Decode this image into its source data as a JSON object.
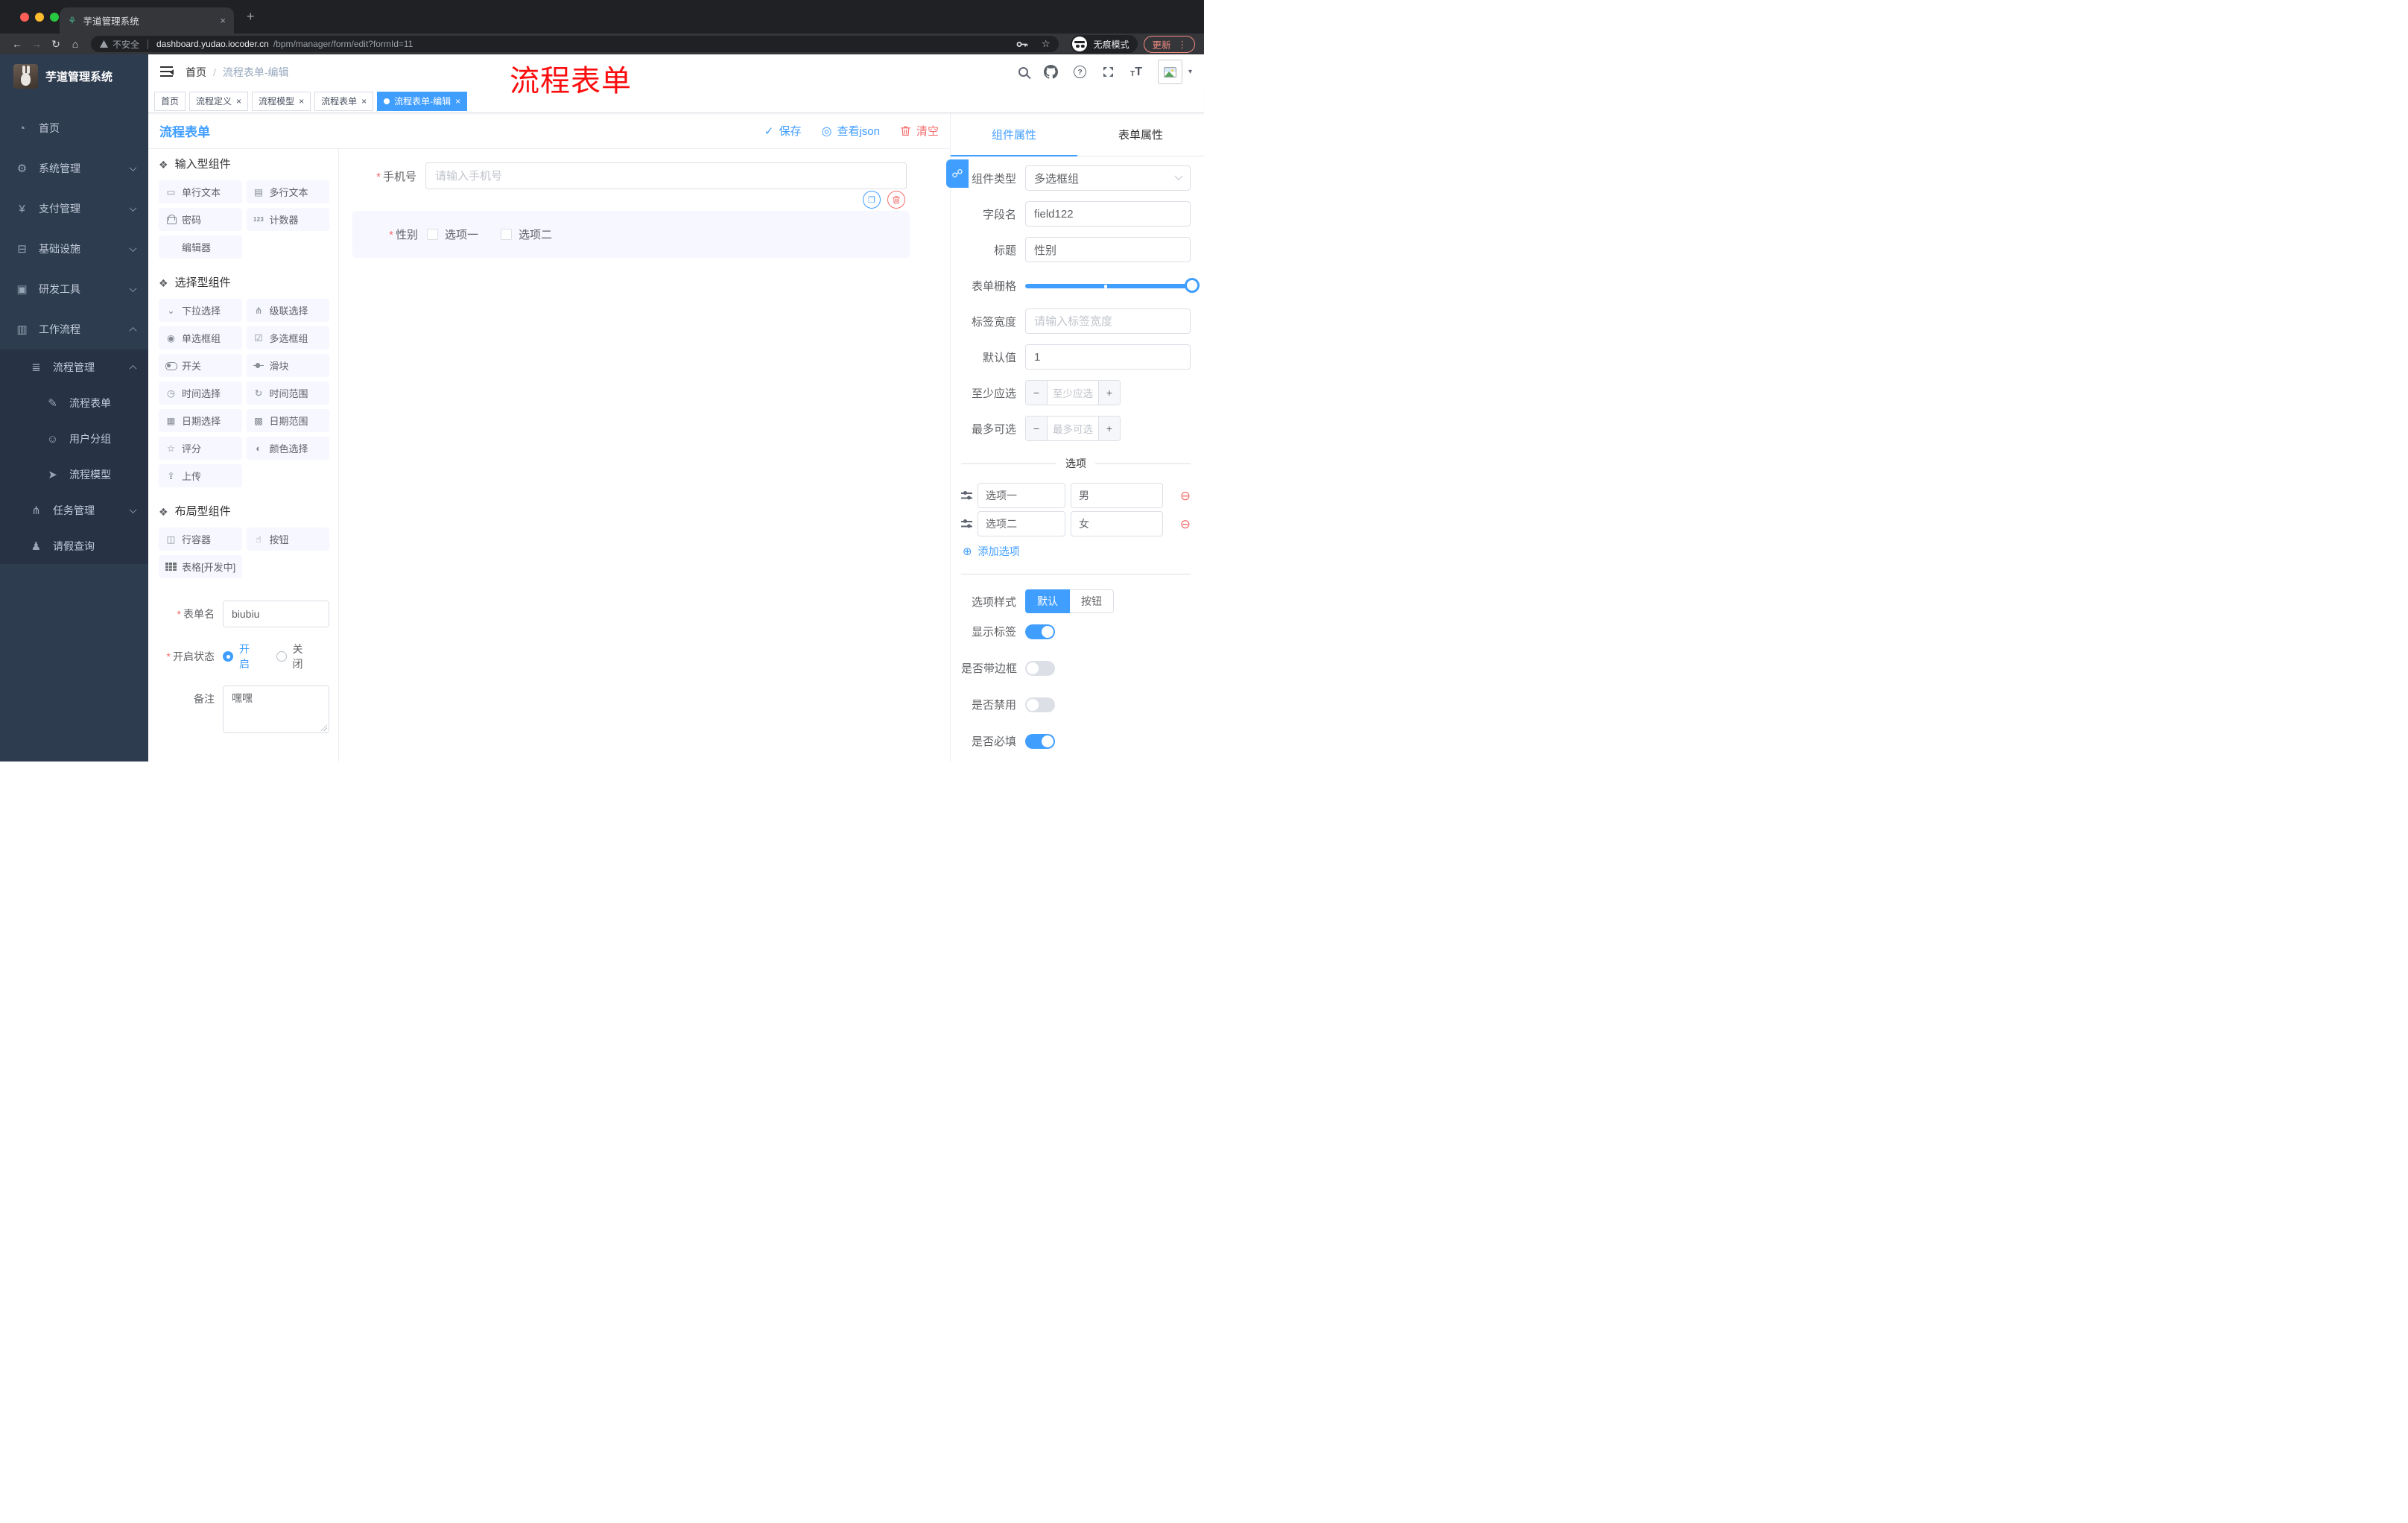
{
  "browser": {
    "tab_title": "芋道管理系统",
    "security": "不安全",
    "url_host": "dashboard.yudao.iocoder.cn",
    "url_path": "/bpm/manager/form/edit?formId=11",
    "incognito": "无痕模式",
    "update": "更新"
  },
  "icons": {
    "plant": "⚘",
    "close": "×",
    "new_tab": "+",
    "back": "←",
    "forward": "→",
    "reload": "↻",
    "home": "⌂",
    "star": "☆",
    "dots": "⋮",
    "caret": "▾",
    "section": "❖",
    "check": "✓",
    "eye": "◎",
    "copy": "❐",
    "chain": "☍",
    "minus": "−",
    "plus": "+",
    "minus_circle": "⊖",
    "plus_circle": "⊕",
    "asterisk": "*",
    "breadcrumb_sep": "/",
    "question": "?",
    "font_t": "T"
  },
  "sidebar": {
    "app_title": "芋道管理系统",
    "menu": [
      {
        "icon": "◔",
        "label": "首页",
        "level": 1
      },
      {
        "icon": "⚙",
        "label": "系统管理",
        "level": 1,
        "arrow": "down"
      },
      {
        "icon": "¥",
        "label": "支付管理",
        "level": 1,
        "arrow": "down"
      },
      {
        "icon": "⊟",
        "label": "基础设施",
        "level": 1,
        "arrow": "down"
      },
      {
        "icon": "▣",
        "label": "研发工具",
        "level": 1,
        "arrow": "down"
      },
      {
        "icon": "▥",
        "label": "工作流程",
        "level": 1,
        "arrow": "up"
      },
      {
        "icon": "≣",
        "label": "流程管理",
        "level": 2,
        "arrow": "up",
        "group": true
      },
      {
        "icon": "✎",
        "label": "流程表单",
        "level": 3,
        "group": true
      },
      {
        "icon": "☺",
        "label": "用户分组",
        "level": 3,
        "group": true
      },
      {
        "icon": "➤",
        "label": "流程模型",
        "level": 3,
        "group": true
      },
      {
        "icon": "⋔",
        "label": "任务管理",
        "level": 2,
        "arrow": "down",
        "group": true
      },
      {
        "icon": "♟",
        "label": "请假查询",
        "level": 2,
        "group": true
      }
    ]
  },
  "header": {
    "breadcrumb": [
      "首页",
      "流程表单-编辑"
    ],
    "overlay": "流程表单"
  },
  "tags": [
    {
      "label": "首页"
    },
    {
      "label": "流程定义",
      "closable": true
    },
    {
      "label": "流程模型",
      "closable": true
    },
    {
      "label": "流程表单",
      "closable": true
    },
    {
      "label": "流程表单-编辑",
      "closable": true,
      "active": true
    }
  ],
  "toolbar": {
    "title": "流程表单",
    "save": "保存",
    "view_json": "查看json",
    "clear": "清空"
  },
  "palette": {
    "sections": [
      {
        "title": "输入型组件",
        "items": [
          {
            "icon": "▭",
            "label": "单行文本"
          },
          {
            "icon": "▤",
            "label": "多行文本"
          },
          {
            "icon": "css:lock",
            "label": "密码"
          },
          {
            "icon": "123",
            "label": "计数器"
          },
          {
            "icon": "",
            "label": "编辑器"
          }
        ]
      },
      {
        "title": "选择型组件",
        "items": [
          {
            "icon": "⌄",
            "label": "下拉选择"
          },
          {
            "icon": "⋔",
            "label": "级联选择"
          },
          {
            "icon": "◉",
            "label": "单选框组"
          },
          {
            "icon": "☑",
            "label": "多选框组"
          },
          {
            "icon": "css:switch",
            "label": "开关"
          },
          {
            "icon": "css:sliderline",
            "label": "滑块"
          },
          {
            "icon": "◷",
            "label": "时间选择"
          },
          {
            "icon": "↻",
            "label": "时间范围"
          },
          {
            "icon": "▦",
            "label": "日期选择"
          },
          {
            "icon": "▩",
            "label": "日期范围"
          },
          {
            "icon": "☆",
            "label": "评分"
          },
          {
            "icon": "◐",
            "label": "颜色选择"
          },
          {
            "icon": "⇪",
            "label": "上传"
          }
        ]
      },
      {
        "title": "布局型组件",
        "items": [
          {
            "icon": "◫",
            "label": "行容器"
          },
          {
            "icon": "☝",
            "label": "按钮"
          },
          {
            "icon": "css:grid",
            "label": "表格[开发中]"
          }
        ]
      }
    ]
  },
  "builder_form": {
    "name_label": "表单名",
    "name_value": "biubiu",
    "status_label": "开启状态",
    "status_options": [
      {
        "label": "开启",
        "checked": true
      },
      {
        "label": "关闭",
        "checked": false
      }
    ],
    "remark_label": "备注",
    "remark_value": "嘿嘿"
  },
  "canvas": {
    "phone": {
      "label": "手机号",
      "required": true,
      "placeholder": "请输入手机号"
    },
    "gender": {
      "label": "性别",
      "required": true,
      "options": [
        "选项一",
        "选项二"
      ]
    }
  },
  "props_panel": {
    "tabs": [
      {
        "label": "组件属性",
        "active": true
      },
      {
        "label": "表单属性"
      }
    ],
    "component_type": {
      "label": "组件类型",
      "value": "多选框组"
    },
    "field_name": {
      "label": "字段名",
      "value": "field122"
    },
    "title": {
      "label": "标题",
      "value": "性别"
    },
    "grid": {
      "label": "表单栅格"
    },
    "label_width": {
      "label": "标签宽度",
      "placeholder": "请输入标签宽度"
    },
    "default_value": {
      "label": "默认值",
      "value": "1"
    },
    "min_select": {
      "label": "至少应选",
      "placeholder": "至少应选"
    },
    "max_select": {
      "label": "最多可选",
      "placeholder": "最多可选"
    },
    "options_divider": "选项",
    "options": [
      {
        "label": "选项一",
        "value": "男"
      },
      {
        "label": "选项二",
        "value": "女"
      }
    ],
    "add_option": "添加选项",
    "option_style": {
      "label": "选项样式",
      "options": [
        {
          "label": "默认",
          "active": true
        },
        {
          "label": "按钮"
        }
      ]
    },
    "toggles": [
      {
        "label": "显示标签",
        "on": true
      },
      {
        "label": "是否带边框",
        "on": false
      },
      {
        "label": "是否禁用",
        "on": false
      },
      {
        "label": "是否必填",
        "on": true
      }
    ]
  },
  "colors": {
    "accent": "#409eff",
    "danger": "#f56c6c",
    "annotation_red": "#fb0d0d",
    "sidebar_bg": "#2e3c50",
    "submenu_bg": "#273345",
    "palette_item_bg": "#f6f7ff",
    "update_chip": "#f28b82"
  }
}
